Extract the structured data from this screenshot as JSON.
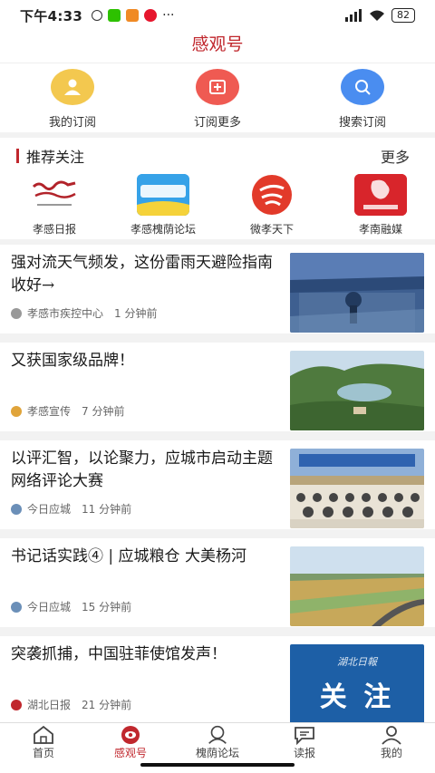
{
  "status": {
    "time": "下午4:33",
    "battery": "82"
  },
  "header": {
    "title": "感观号"
  },
  "actions": [
    {
      "label": "我的订阅",
      "icon": "user-icon",
      "color": "#f3c84f"
    },
    {
      "label": "订阅更多",
      "icon": "add-subscription-icon",
      "color": "#ef5a52"
    },
    {
      "label": "搜索订阅",
      "icon": "search-icon",
      "color": "#4a8df0"
    }
  ],
  "recommend": {
    "title": "推荐关注",
    "more": "更多",
    "items": [
      {
        "label": "孝感日报"
      },
      {
        "label": "孝感槐荫论坛"
      },
      {
        "label": "微孝天下"
      },
      {
        "label": "孝南融媒"
      }
    ]
  },
  "news": [
    {
      "title": "强对流天气频发，这份雷雨天避险指南收好→",
      "source": "孝感市疾控中心",
      "time": "1 分钟前"
    },
    {
      "title": "又获国家级品牌！",
      "source": "孝感宣传",
      "time": "7 分钟前"
    },
    {
      "title": "以评汇智，以论聚力，应城市启动主题网络评论大赛",
      "source": "今日应城",
      "time": "11 分钟前"
    },
    {
      "title": "书记话实践④ | 应城粮仓 大美杨河",
      "source": "今日应城",
      "time": "15 分钟前"
    },
    {
      "title": "突袭抓捕，中国驻菲使馆发声！",
      "source": "湖北日报",
      "time": "21 分钟前"
    }
  ],
  "thumb_text": {
    "last_top": "湖北日報",
    "last_main": "关 注"
  },
  "bottom_nav": [
    {
      "label": "首页",
      "icon": "home-icon"
    },
    {
      "label": "感观号",
      "icon": "eye-icon",
      "active": true
    },
    {
      "label": "槐荫论坛",
      "icon": "forum-icon"
    },
    {
      "label": "读报",
      "icon": "chat-icon"
    },
    {
      "label": "我的",
      "icon": "profile-icon"
    }
  ],
  "colors": {
    "accent": "#c0272d"
  }
}
